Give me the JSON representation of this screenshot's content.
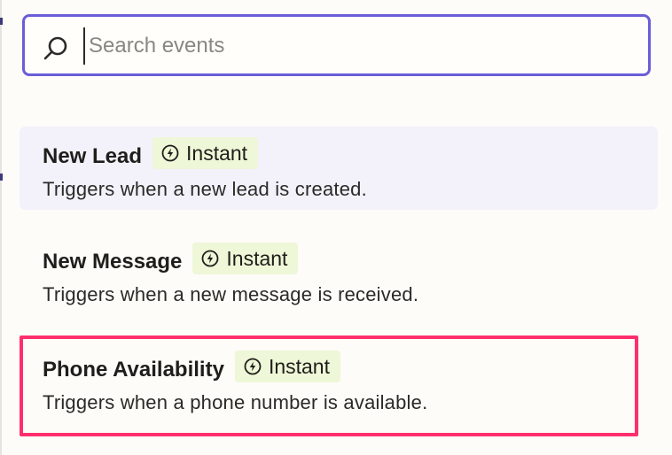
{
  "search": {
    "placeholder": "Search events",
    "value": ""
  },
  "events": [
    {
      "name": "New Lead",
      "badge": "Instant",
      "description": "Triggers when a new lead is created."
    },
    {
      "name": "New Message",
      "badge": "Instant",
      "description": "Triggers when a new message is received."
    },
    {
      "name": "Phone Availability",
      "badge": "Instant",
      "description": "Triggers when a phone number is available."
    }
  ],
  "colors": {
    "search_border": "#6a5ed8",
    "active_row_bg": "#f3f2fb",
    "badge_bg": "#eef7d7",
    "highlight_border": "#ff2f6e"
  },
  "icons": {
    "search": "search-icon",
    "badge": "bolt-icon"
  }
}
